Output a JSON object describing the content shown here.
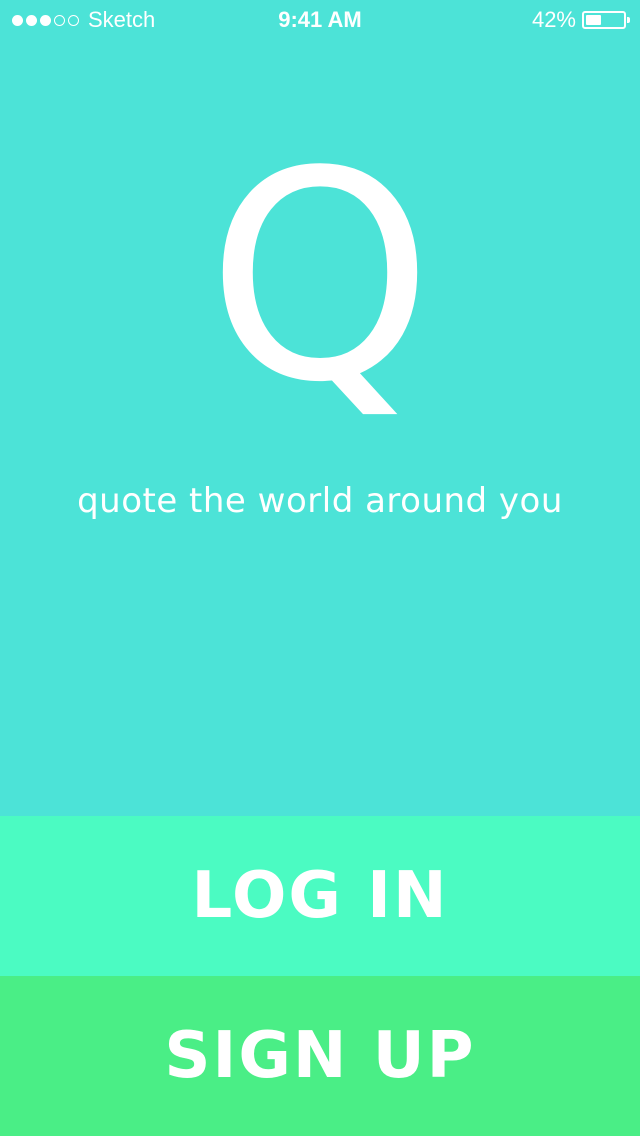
{
  "status_bar": {
    "carrier": "Sketch",
    "signal_bars_filled": 3,
    "signal_bars_total": 5,
    "time": "9:41 AM",
    "battery_percent_label": "42%",
    "battery_level": 0.42
  },
  "hero": {
    "logo_letter": "Q",
    "tagline": "quote the world around you"
  },
  "actions": {
    "login_label": "LOG IN",
    "signup_label": "SIGN UP"
  },
  "colors": {
    "background": "#4ce3d7",
    "login_button": "#4bfbc2",
    "signup_button": "#4aee86",
    "text": "#ffffff"
  },
  "icons": {
    "signal": "signal-dots-icon",
    "battery": "battery-icon"
  }
}
